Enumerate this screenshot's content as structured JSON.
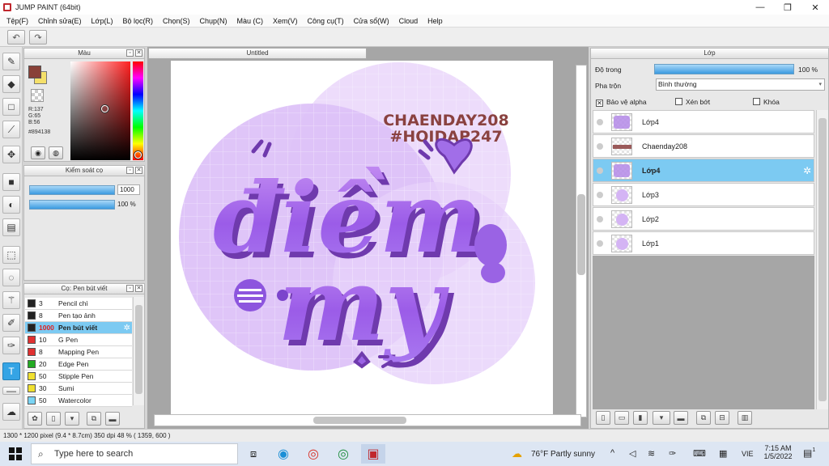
{
  "window": {
    "title": "JUMP PAINT (64bit)",
    "minimize_glyph": "—",
    "maximize_glyph": "❐",
    "close_glyph": "✕"
  },
  "menu": [
    "Tệp(F)",
    "Chỉnh sửa(E)",
    "Lớp(L)",
    "Bộ lọc(R)",
    "Chọn(S)",
    "Chụp(N)",
    "Màu (C)",
    "Xem(V)",
    "Công cụ(T)",
    "Cửa sổ(W)",
    "Cloud",
    "Help"
  ],
  "toolbar": {
    "undo_icon": "↶",
    "redo_icon": "↷"
  },
  "color_panel": {
    "title": "Màu",
    "foreground_color": "#894138",
    "background_color": "#f5e06a",
    "r": "R:137",
    "g": "G:65",
    "b": "B:56",
    "hex": "#894138"
  },
  "brush_control": {
    "title": "Kiểm soát cọ",
    "size_value": "1000",
    "opacity_label": "100 %",
    "size_fill": 1.0,
    "opacity_fill": 1.0
  },
  "brush_list": {
    "title": "Cọ: Pen bút viết",
    "items": [
      {
        "size": "3",
        "name": "Pencil chì",
        "color": "#222222",
        "selected": false
      },
      {
        "size": "8",
        "name": "Pen tạo ảnh",
        "color": "#222222",
        "selected": false
      },
      {
        "size": "1000",
        "name": "Pen bút viết",
        "color": "#222222",
        "selected": true
      },
      {
        "size": "10",
        "name": "G Pen",
        "color": "#e03030",
        "selected": false
      },
      {
        "size": "8",
        "name": "Mapping Pen",
        "color": "#e03030",
        "selected": false
      },
      {
        "size": "20",
        "name": "Edge Pen",
        "color": "#22aa22",
        "selected": false
      },
      {
        "size": "50",
        "name": "Stipple Pen",
        "color": "#f0e030",
        "selected": false
      },
      {
        "size": "30",
        "name": "Sumi",
        "color": "#f0e030",
        "selected": false
      },
      {
        "size": "50",
        "name": "Watercolor",
        "color": "#7ad4f4",
        "selected": false
      }
    ]
  },
  "canvas": {
    "tab_title": "Untitled",
    "artwork_text_1": "CHAENDAY208",
    "artwork_text_2": "#HOIDAP247",
    "artwork_word_1": "điềm",
    "artwork_word_2": "my"
  },
  "layer_panel": {
    "title": "Lớp",
    "opacity_label": "Độ trong",
    "opacity_value": "100 %",
    "opacity_fill": 1.0,
    "blend_label": "Pha trộn",
    "blend_value": "Bình thường",
    "protect_alpha": "Bảo vệ alpha",
    "clipping": "Xén bớt",
    "lock": "Khóa",
    "layers": [
      {
        "name": "Lớp4",
        "selected": false,
        "thumb": "text"
      },
      {
        "name": "Chaenday208",
        "selected": false,
        "thumb": "label"
      },
      {
        "name": "Lớp4",
        "selected": true,
        "thumb": "text"
      },
      {
        "name": "Lớp3",
        "selected": false,
        "thumb": "circle"
      },
      {
        "name": "Lớp2",
        "selected": false,
        "thumb": "circle"
      },
      {
        "name": "Lớp1",
        "selected": false,
        "thumb": "circle"
      }
    ]
  },
  "status": {
    "size": "1300 * 1200 pixel",
    "physical": "(9.4 * 8.7cm)",
    "dpi": "350 dpi",
    "zoom": "48 %",
    "cursor": "( 1359, 600 )"
  },
  "taskbar": {
    "search_placeholder": "Type here to search",
    "weather": "76°F  Partly sunny",
    "language": "VIE",
    "time": "7:15 AM",
    "date": "1/5/2022",
    "notif_count": "1"
  }
}
